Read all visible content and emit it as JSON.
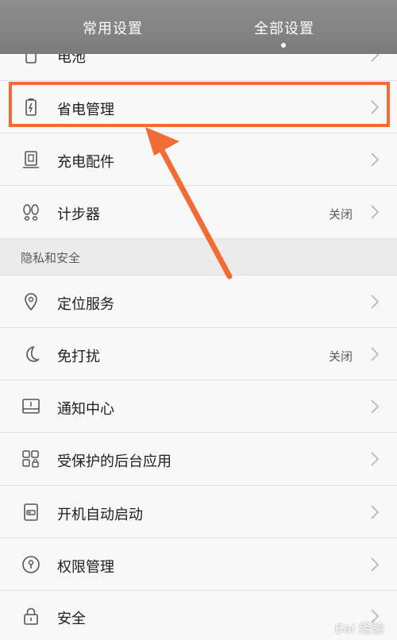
{
  "header": {
    "tabs": [
      {
        "label": "常用设置"
      },
      {
        "label": "全部设置"
      }
    ]
  },
  "rows": {
    "battery": {
      "label": "电池",
      "icon": "battery-icon"
    },
    "power_saving": {
      "label": "省电管理",
      "icon": "power-saving-icon"
    },
    "charging_accessories": {
      "label": "充电配件",
      "icon": "charger-icon"
    },
    "pedometer": {
      "label": "计步器",
      "value": "关闭",
      "icon": "footprints-icon"
    },
    "location": {
      "label": "定位服务",
      "icon": "location-pin-icon"
    },
    "dnd": {
      "label": "免打扰",
      "value": "关闭",
      "icon": "moon-icon"
    },
    "notifications": {
      "label": "通知中心",
      "icon": "notification-tray-icon"
    },
    "protected_apps": {
      "label": "受保护的后台应用",
      "icon": "app-grid-lock-icon"
    },
    "autostart": {
      "label": "开机自动启动",
      "icon": "autostart-icon"
    },
    "permissions": {
      "label": "权限管理",
      "icon": "keyhole-icon"
    },
    "security": {
      "label": "安全",
      "icon": "padlock-icon"
    }
  },
  "sections": {
    "privacy": {
      "label": "隐私和安全"
    }
  },
  "annotation": {
    "color": "#f26c35"
  },
  "watermark": {
    "text": "Bai 经验"
  }
}
